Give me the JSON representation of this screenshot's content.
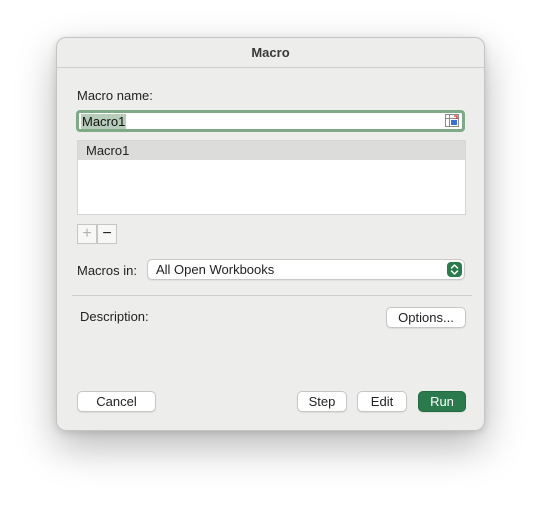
{
  "dialog": {
    "title": "Macro",
    "macro_name_label": "Macro name:",
    "macro_name_value": "Macro1",
    "macro_list": [
      "Macro1"
    ],
    "add_label": "+",
    "remove_label": "−",
    "macros_in_label": "Macros in:",
    "macros_in_value": "All Open Workbooks",
    "description_label": "Description:",
    "options_label": "Options...",
    "cancel_label": "Cancel",
    "step_label": "Step",
    "edit_label": "Edit",
    "run_label": "Run",
    "accent_color": "#2b7a4d",
    "icons": {
      "reference": "cell-reference-icon",
      "select_arrows": "updown-chevron-icon"
    }
  }
}
